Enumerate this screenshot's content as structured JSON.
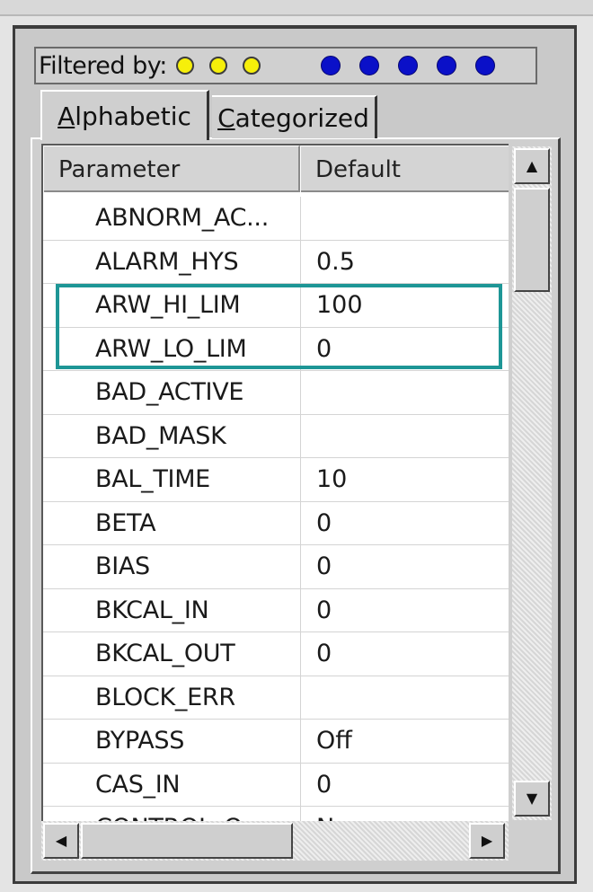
{
  "filter": {
    "label": "Filtered by:",
    "yellow_dots": 3,
    "blue_dots": 5,
    "colors": {
      "yellow": "#f6ef0a",
      "blue": "#0a10c8"
    }
  },
  "tabs": [
    {
      "label_rest": "lphabetic",
      "underline": "A",
      "active": true
    },
    {
      "label_rest": "ategorized",
      "underline": "C",
      "active": false
    }
  ],
  "grid": {
    "headers": {
      "parameter": "Parameter",
      "default": "Default"
    },
    "rows": [
      {
        "name": "ABNORM_AC...",
        "value": ""
      },
      {
        "name": "ALARM_HYS",
        "value": "0.5"
      },
      {
        "name": "ARW_HI_LIM",
        "value": "100"
      },
      {
        "name": "ARW_LO_LIM",
        "value": "0"
      },
      {
        "name": "BAD_ACTIVE",
        "value": ""
      },
      {
        "name": "BAD_MASK",
        "value": ""
      },
      {
        "name": "BAL_TIME",
        "value": "10"
      },
      {
        "name": "BETA",
        "value": "0"
      },
      {
        "name": "BIAS",
        "value": "0"
      },
      {
        "name": "BKCAL_IN",
        "value": "0"
      },
      {
        "name": "BKCAL_OUT",
        "value": "0"
      },
      {
        "name": "BLOCK_ERR",
        "value": ""
      },
      {
        "name": "BYPASS",
        "value": "Off"
      },
      {
        "name": "CAS_IN",
        "value": "0"
      },
      {
        "name": "CONTROL_O...",
        "value": "N..."
      }
    ],
    "highlight_color": "#1e9696"
  },
  "scrollbars": {
    "up_icon": "up-arrow-icon",
    "down_icon": "down-arrow-icon",
    "left_icon": "left-arrow-icon",
    "right_icon": "right-arrow-icon"
  }
}
